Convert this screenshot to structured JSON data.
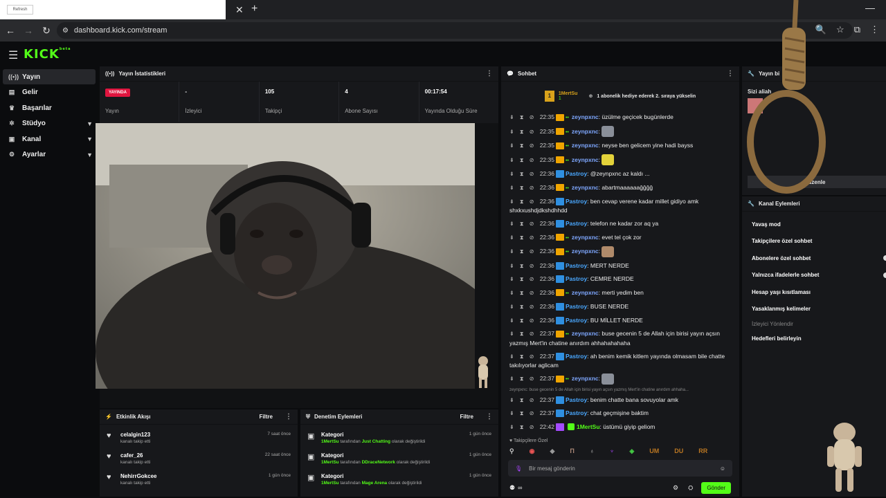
{
  "browser": {
    "tab_favicon_text": "Refresh",
    "tab_title": "",
    "close_glyph": "✕",
    "new_tab_glyph": "+",
    "minimize_glyph": "—",
    "url": "dashboard.kick.com/stream"
  },
  "app": {
    "logo": "KICK",
    "logo_tag": "beta"
  },
  "sidebar": {
    "items": [
      {
        "label": "Yayın",
        "icon": "broadcast-icon"
      },
      {
        "label": "Gelir",
        "icon": "revenue-icon"
      },
      {
        "label": "Başarılar",
        "icon": "trophy-icon"
      },
      {
        "label": "Stüdyo",
        "icon": "studio-icon"
      },
      {
        "label": "Kanal",
        "icon": "channel-icon"
      },
      {
        "label": "Ayarlar",
        "icon": "settings-icon"
      }
    ]
  },
  "stats_panel": {
    "title": "Yayın İstatistikleri",
    "live_badge": "YAYINDA",
    "stats": [
      {
        "value": "",
        "label": "Yayın"
      },
      {
        "value": "-",
        "label": "İzleyici"
      },
      {
        "value": "105",
        "label": "Takipçi"
      },
      {
        "value": "4",
        "label": "Abone Sayısı"
      },
      {
        "value": "00:17:54",
        "label": "Yayında Olduğu Süre"
      }
    ]
  },
  "activity_panel": {
    "title": "Etkinlik Akışı",
    "filter": "Filtre",
    "items": [
      {
        "name": "celalgin123",
        "desc": "kanalı takip etti",
        "time": "7 saat önce"
      },
      {
        "name": "cafer_26",
        "desc": "kanalı takip etti",
        "time": "22 saat önce"
      },
      {
        "name": "NehirrGokcee",
        "desc": "kanalı takip etti",
        "time": "1 gün önce"
      }
    ]
  },
  "moderation_panel": {
    "title": "Denetim Eylemleri",
    "filter": "Filtre",
    "items": [
      {
        "title": "Kategori",
        "user": "1MertSu",
        "mid": "tarafından",
        "target": "Just Chatting",
        "end": "olarak değiştirildi",
        "time": "1 gün önce"
      },
      {
        "title": "Kategori",
        "user": "1MertSu",
        "mid": "tarafından",
        "target": "DDraceNetwork",
        "end": "olarak değiştirildi",
        "time": "1 gün önce"
      },
      {
        "title": "Kategori",
        "user": "1MertSu",
        "mid": "tarafından",
        "target": "Mage Arena",
        "end": "olarak değiştirildi",
        "time": "1 gün önce"
      }
    ]
  },
  "chat": {
    "title": "Sohbet",
    "pinned_user": "1MertSu",
    "pinned_count": "1",
    "pinned_text": "1 abonelik hediye ederek 2. sıraya yükselin",
    "messages": [
      {
        "time": "22:35",
        "user": "zeynpxnc",
        "badge": "crown",
        "text": "üzülme geçicek bugünlerde"
      },
      {
        "time": "22:35",
        "user": "zeynpxnc",
        "badge": "crown",
        "text": "",
        "sticker": "#8a8f99"
      },
      {
        "time": "22:35",
        "user": "zeynpxnc",
        "badge": "crown",
        "text": "neyse ben gelicem yine hadi bayss"
      },
      {
        "time": "22:35",
        "user": "zeynpxnc",
        "badge": "crown",
        "text": "",
        "sticker": "#e3d23a"
      },
      {
        "time": "22:36",
        "user": "Pastroy",
        "badge": "blue",
        "text": "@zeynpxnc az kaldı ..."
      },
      {
        "time": "22:36",
        "user": "zeynpxnc",
        "badge": "crown",
        "text": "abartmaaaaaağğğğ"
      },
      {
        "time": "22:36",
        "user": "Pastroy",
        "badge": "blue",
        "text": "ben cevap verene kadar millet gidiyo amk shxkxushdjdkshdhhdd",
        "wrap": true
      },
      {
        "time": "22:36",
        "user": "Pastroy",
        "badge": "blue",
        "text": "telefon ne kadar zor aq ya"
      },
      {
        "time": "22:36",
        "user": "zeynpxnc",
        "badge": "crown",
        "text": "evet tel çok zor"
      },
      {
        "time": "22:36",
        "user": "zeynpxnc",
        "badge": "crown",
        "text": "",
        "sticker": "#b08a6a"
      },
      {
        "time": "22:36",
        "user": "Pastroy",
        "badge": "blue",
        "text": "MERT NERDE"
      },
      {
        "time": "22:36",
        "user": "Pastroy",
        "badge": "blue",
        "text": "CEMRE NERDE"
      },
      {
        "time": "22:36",
        "user": "zeynpxnc",
        "badge": "crown",
        "text": "merti yedim ben"
      },
      {
        "time": "22:36",
        "user": "Pastroy",
        "badge": "blue",
        "text": "BUSE NERDE"
      },
      {
        "time": "22:36",
        "user": "Pastroy",
        "badge": "blue",
        "text": "BU MİLLET NERDE"
      },
      {
        "time": "22:37",
        "user": "zeynpxnc",
        "badge": "crown",
        "text": "buse gecenin 5 de Allah için birisi yayın açsın yazmış Mert'in chatine anırdım ahhahahahaha",
        "wrap": true
      },
      {
        "time": "22:37",
        "user": "Pastroy",
        "badge": "blue",
        "text": "ah benim kemik kitlem yayında olmasam bile chatte takılıyorlar aglicam",
        "wrap": true
      },
      {
        "time": "22:37",
        "user": "zeynpxnc",
        "badge": "crown",
        "text": "",
        "sticker": "#8a8f99"
      },
      {
        "time": "22:37",
        "user": "Pastroy",
        "badge": "blue",
        "text": "benim chatte bana sovuyolar amk",
        "reply": "zeynpxnc: buse gecenin 5 de Allah için birisi yayın açsın yazmış Mert'in chatine anırdım ahhaha..."
      },
      {
        "time": "22:37",
        "user": "Pastroy",
        "badge": "blue",
        "text": "chat geçmişine baktim"
      },
      {
        "time": "22:42",
        "user": "1MertSu",
        "badge": "mert",
        "text": "üstümü giyip geliom"
      }
    ],
    "follower_only_label": "Takipçilere Özel",
    "emote_labels": [
      "UM",
      "DU",
      "RR"
    ],
    "input_placeholder": "Bir mesaj gönderin",
    "infinity": "∞",
    "send_button": "Gönder"
  },
  "right_panel": {
    "top_title": "Yayın bi",
    "top_sub": "Sizi aliah",
    "top_button": "üzenle",
    "actions_title": "Kanal Eylemleri",
    "actions": [
      {
        "label": "Yavaş mod",
        "toggle": false,
        "dim": false
      },
      {
        "label": "Takipçilere özel sohbet",
        "toggle": false,
        "dim": false
      },
      {
        "label": "Abonelere özel sohbet",
        "toggle": true,
        "dim": false
      },
      {
        "label": "Yalnızca ifadelerle sohbet",
        "toggle": true,
        "dim": false
      },
      {
        "label": "Hesap yaşı kısıtlaması",
        "toggle": false,
        "dim": false
      },
      {
        "label": "Yasaklanmış kelimeler",
        "toggle": false,
        "dim": false
      },
      {
        "label": "İzleyici Yönlendir",
        "toggle": false,
        "dim": true
      },
      {
        "label": "Hedefleri belirleyin",
        "toggle": false,
        "dim": false
      }
    ]
  },
  "colors": {
    "kick_green": "#53fc18",
    "live_red": "#e0153f",
    "panel_bg": "#17181b"
  }
}
